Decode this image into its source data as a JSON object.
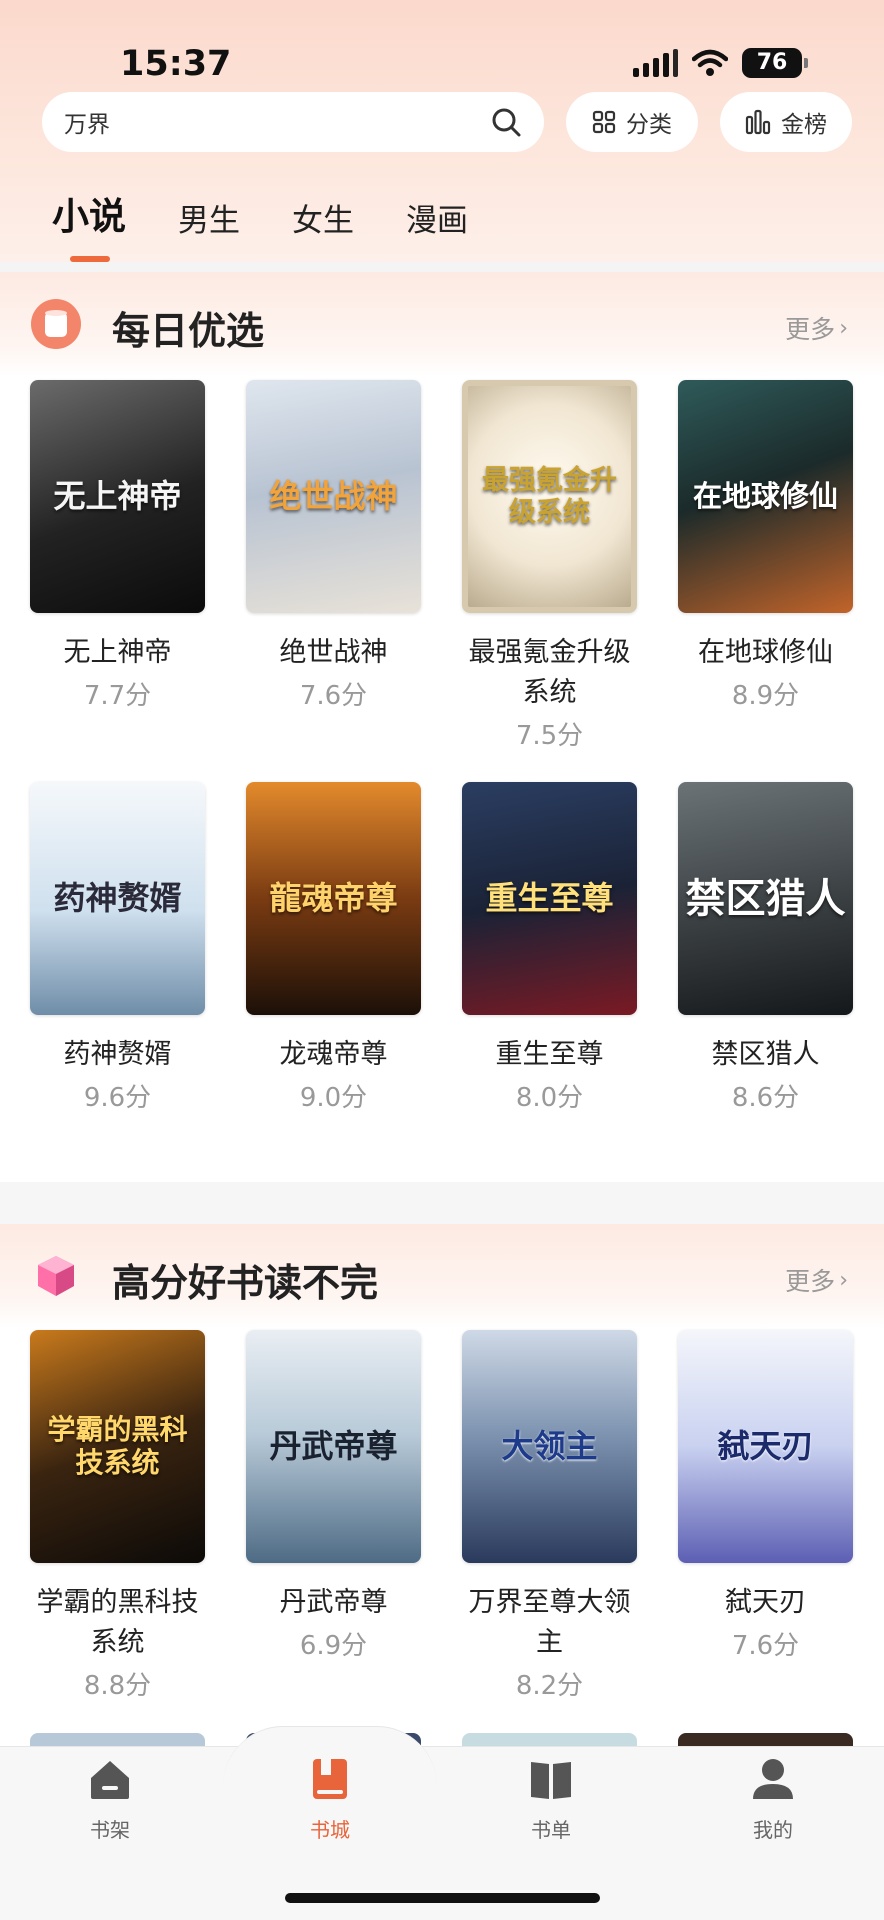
{
  "status": {
    "time": "15:37",
    "battery": "76"
  },
  "search": {
    "query": "万界"
  },
  "header_buttons": {
    "category": "分类",
    "rank": "金榜"
  },
  "tabs": [
    {
      "label": "小说"
    },
    {
      "label": "男生"
    },
    {
      "label": "女生"
    },
    {
      "label": "漫画"
    }
  ],
  "sections": [
    {
      "title": "每日优选",
      "more": "更多",
      "books": [
        {
          "title": "无上神帝",
          "score": "7.7分",
          "cover_text": "无上神帝"
        },
        {
          "title": "绝世战神",
          "score": "7.6分",
          "cover_text": "绝世战神"
        },
        {
          "title": "最强氪金升级系统",
          "score": "7.5分",
          "cover_text": "最强氪金升级系统"
        },
        {
          "title": "在地球修仙",
          "score": "8.9分",
          "cover_text": "在地球修仙"
        },
        {
          "title": "药神赘婿",
          "score": "9.6分",
          "cover_text": "药神赘婿"
        },
        {
          "title": "龙魂帝尊",
          "score": "9.0分",
          "cover_text": "龍魂帝尊"
        },
        {
          "title": "重生至尊",
          "score": "8.0分",
          "cover_text": "重生至尊"
        },
        {
          "title": "禁区猎人",
          "score": "8.6分",
          "cover_text": "禁区猎人"
        }
      ]
    },
    {
      "title": "高分好书读不完",
      "more": "更多",
      "books": [
        {
          "title": "学霸的黑科技系统",
          "score": "8.8分",
          "cover_text": "学霸的黑科技系统"
        },
        {
          "title": "丹武帝尊",
          "score": "6.9分",
          "cover_text": "丹武帝尊"
        },
        {
          "title": "万界至尊大领主",
          "score": "8.2分",
          "cover_text": "大领主"
        },
        {
          "title": "弑天刃",
          "score": "7.6分",
          "cover_text": "弑天刃"
        }
      ]
    }
  ],
  "bottom_nav": [
    {
      "label": "书架"
    },
    {
      "label": "书城"
    },
    {
      "label": "书单"
    },
    {
      "label": "我的"
    }
  ],
  "colors": {
    "accent": "#e8643a",
    "header_bg": "#fbd9cc"
  }
}
